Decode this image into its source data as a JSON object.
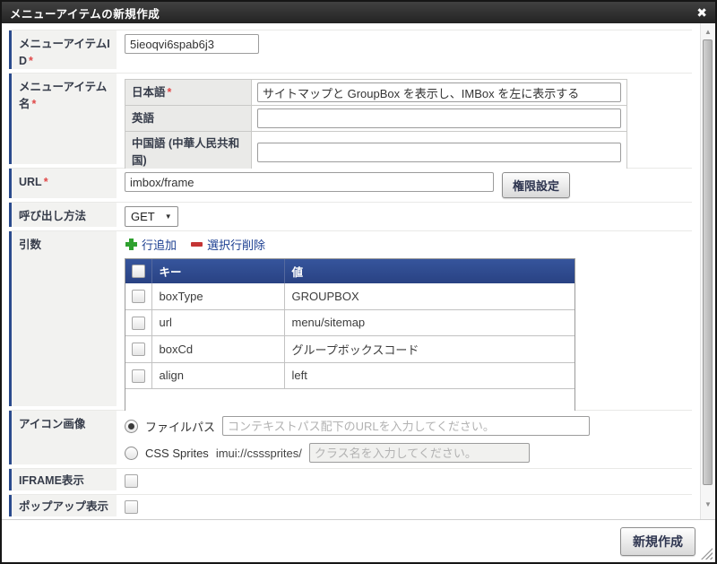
{
  "dialog": {
    "title": "メニューアイテムの新規作成",
    "close_icon": "✖"
  },
  "icons": {
    "scroll_up": "▲",
    "scroll_down": "▼",
    "select_arrow": "▼"
  },
  "colors": {
    "titlebar": "#2e2e2e",
    "accent_navy": "#2a4a8c",
    "table_header_blue": "#2f4d94",
    "link_blue": "#1c3f91",
    "required_red": "#e04848",
    "add_green": "#2fa12f",
    "delete_red": "#c43434"
  },
  "form": {
    "menu_item_id": {
      "label": "メニューアイテムID",
      "required": "*",
      "value": "5ieoqvi6spab6j3"
    },
    "menu_item_name": {
      "label": "メニューアイテム名",
      "required": "*",
      "locales": [
        {
          "label": "日本語",
          "required": "*",
          "value": "サイトマップと GroupBox を表示し、IMBox を左に表示する"
        },
        {
          "label": "英語",
          "required": "",
          "value": ""
        },
        {
          "label": "中国語 (中華人民共和国)",
          "required": "",
          "value": ""
        }
      ]
    },
    "url": {
      "label": "URL",
      "required": "*",
      "value": "imbox/frame",
      "permission_button": "権限設定"
    },
    "method": {
      "label": "呼び出し方法",
      "value": "GET"
    },
    "args": {
      "label": "引数",
      "add_row_label": "行追加",
      "delete_rows_label": "選択行削除",
      "columns": {
        "key": "キー",
        "value": "値"
      },
      "rows": [
        {
          "key": "boxType",
          "value": "GROUPBOX"
        },
        {
          "key": "url",
          "value": "menu/sitemap"
        },
        {
          "key": "boxCd",
          "value": "グループボックスコード"
        },
        {
          "key": "align",
          "value": "left"
        }
      ]
    },
    "icon_image": {
      "label": "アイコン画像",
      "file_path_label": "ファイルパス",
      "file_path_placeholder": "コンテキストパス配下のURLを入力してください。",
      "css_sprites_label": "CSS Sprites",
      "css_sprites_prefix": "imui://csssprites/",
      "css_sprites_placeholder": "クラス名を入力してください。"
    },
    "iframe_display": {
      "label": "IFRAME表示"
    },
    "popup_display": {
      "label": "ポップアップ表示"
    }
  },
  "footer": {
    "create_button": "新規作成"
  }
}
